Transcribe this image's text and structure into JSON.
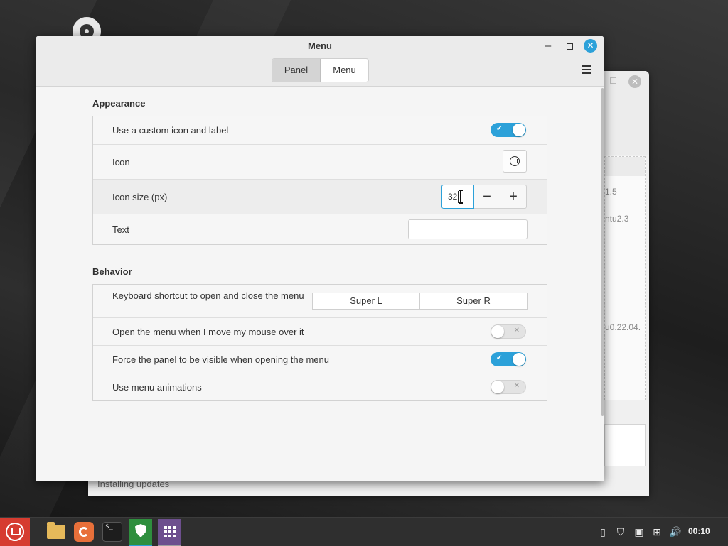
{
  "background_window": {
    "versions": [
      "1.5",
      "ntu2.3",
      "u0.22.04."
    ],
    "status": "Installing updates"
  },
  "window": {
    "title": "Menu",
    "tabs": [
      {
        "label": "Panel",
        "active": true
      },
      {
        "label": "Menu",
        "active": false
      }
    ]
  },
  "appearance": {
    "title": "Appearance",
    "custom_icon_label": "Use a custom icon and label",
    "custom_icon_enabled": true,
    "icon_label": "Icon",
    "icon_size_label": "Icon size (px)",
    "icon_size_value": "32",
    "text_label": "Text",
    "text_value": ""
  },
  "behavior": {
    "title": "Behavior",
    "shortcut_label": "Keyboard shortcut to open and close the menu",
    "shortcut_keys": [
      "Super L",
      "Super R"
    ],
    "hover_label": "Open the menu when I move my mouse over it",
    "hover_enabled": false,
    "force_panel_label": "Force the panel to be visible when opening the menu",
    "force_panel_enabled": true,
    "animations_label": "Use menu animations",
    "animations_enabled": false
  },
  "taskbar": {
    "apps": [
      "menu-icon",
      "files-icon",
      "firefox-icon",
      "terminal-icon",
      "update-manager-icon",
      "apps-grid-icon"
    ],
    "terminal_glyph": "$_",
    "clock": "00:10"
  },
  "colors": {
    "accent": "#2ca1d9",
    "menu_button": "#d63c30"
  }
}
